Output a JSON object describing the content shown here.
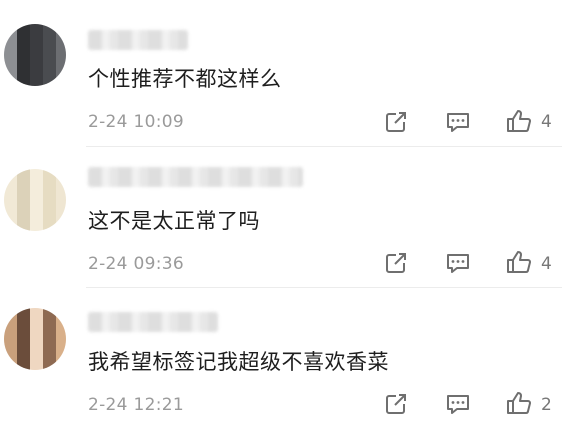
{
  "comments": [
    {
      "text": "个性推荐不都这样么",
      "time": "2-24 10:09",
      "likes": "4",
      "icons": [
        "share-icon",
        "reply-icon",
        "like-icon"
      ],
      "avatar_colors": [
        "#8d8f93",
        "#4a4c50",
        "#b8b9bc",
        "#2f3033",
        "#6c6e72",
        "#d1d1d3",
        "#3b3c40",
        "#9fa1a4"
      ]
    },
    {
      "text": "这不是太正常了吗",
      "time": "2-24 09:36",
      "likes": "4",
      "icons": [
        "share-icon",
        "reply-icon",
        "like-icon"
      ],
      "avatar_colors": [
        "#f1e9d6",
        "#e6dcc2",
        "#f7f1e3",
        "#dcd2b9",
        "#efe6d2",
        "#e9e1cc",
        "#f4eddc",
        "#ddd4bd"
      ]
    },
    {
      "text": "我希望标签记我超级不喜欢香菜",
      "time": "2-24 12:21",
      "likes": "2",
      "icons": [
        "share-icon",
        "reply-icon",
        "like-icon"
      ],
      "avatar_colors": [
        "#c9a07c",
        "#8e6a52",
        "#e3c4a7",
        "#6b4d3b",
        "#d9b08a",
        "#b58a68",
        "#efd7c1",
        "#9c7459"
      ]
    }
  ],
  "colors": {
    "icon": "#6f6f6f",
    "time": "#9a9a9a",
    "divider": "#ececec"
  }
}
